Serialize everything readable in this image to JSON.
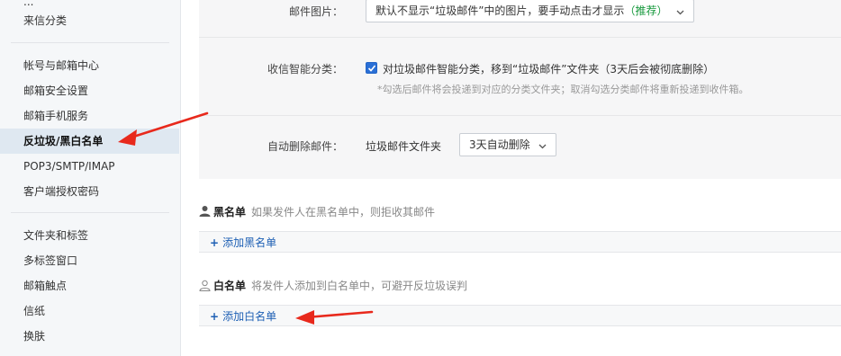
{
  "sidebar": {
    "top_partial": "...",
    "items": [
      {
        "label": "来信分类"
      },
      {
        "label": "帐号与邮箱中心"
      },
      {
        "label": "邮箱安全设置"
      },
      {
        "label": "邮箱手机服务"
      },
      {
        "label": "反垃圾/黑白名单",
        "active": true
      },
      {
        "label": "POP3/SMTP/IMAP"
      },
      {
        "label": "客户端授权密码"
      },
      {
        "label": "文件夹和标签"
      },
      {
        "label": "多标签窗口"
      },
      {
        "label": "邮箱触点"
      },
      {
        "label": "信纸"
      },
      {
        "label": "换肤"
      }
    ]
  },
  "settings": {
    "mail_image": {
      "label": "邮件图片：",
      "value": "默认不显示“垃圾邮件”中的图片，要手动点击才显示",
      "recommend": "（推荐）"
    },
    "smart_classify": {
      "label": "收信智能分类：",
      "checkbox_text": "对垃圾邮件智能分类，移到“垃圾邮件”文件夹（3天后会被彻底删除）",
      "checked": true,
      "hint": "*勾选后邮件将会投递到对应的分类文件夹；取消勾选分类邮件将重新投递到收件箱。"
    },
    "auto_delete": {
      "label": "自动删除邮件：",
      "folder": "垃圾邮件文件夹",
      "value": "3天自动删除"
    }
  },
  "blacklist": {
    "title": "黑名单",
    "desc": "如果发件人在黑名单中，则拒收其邮件",
    "add_label": "添加黑名单"
  },
  "whitelist": {
    "title": "白名单",
    "desc": "将发件人添加到白名单中，可避开反垃圾误判",
    "add_label": "添加白名单"
  },
  "colors": {
    "accent_blue": "#1d5fb4",
    "annotation_red": "#e8291c",
    "recommend_green": "#15983b"
  }
}
